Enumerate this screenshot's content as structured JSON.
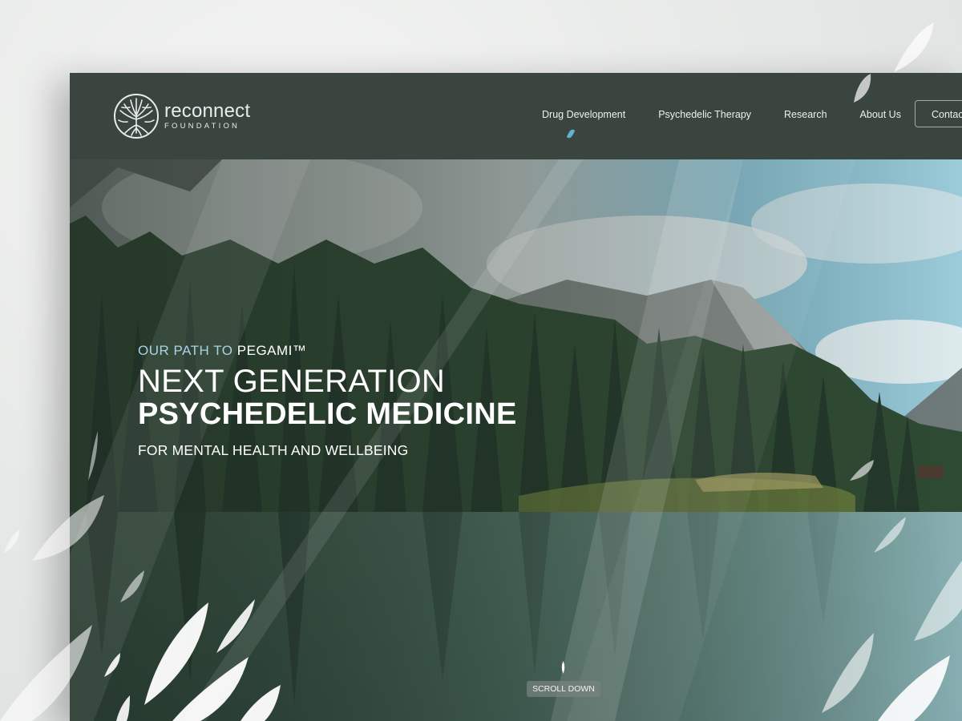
{
  "brand": {
    "name": "reconnect",
    "subtitle": "FOUNDATION"
  },
  "nav": {
    "items": [
      {
        "label": "Drug Development"
      },
      {
        "label": "Psychedelic Therapy"
      },
      {
        "label": "Research"
      },
      {
        "label": "About Us"
      }
    ],
    "contact_label": "Contac"
  },
  "hero": {
    "eyebrow_prefix": "OUR PATH TO ",
    "eyebrow_highlight": "PEGAMI™",
    "headline_line1": "NEXT GENERATION",
    "headline_line2": "PSYCHEDELIC MEDICINE",
    "subheadline": "FOR MENTAL HEALTH AND WELLBEING",
    "scroll_label": "SCROLL DOWN"
  },
  "colors": {
    "header_bg": "#3a4540",
    "accent_blue": "#a9d3e6",
    "text_white": "#ffffff"
  },
  "icons": [
    "tree-logo-icon",
    "leaf-decoration-icon",
    "scroll-drop-icon"
  ]
}
